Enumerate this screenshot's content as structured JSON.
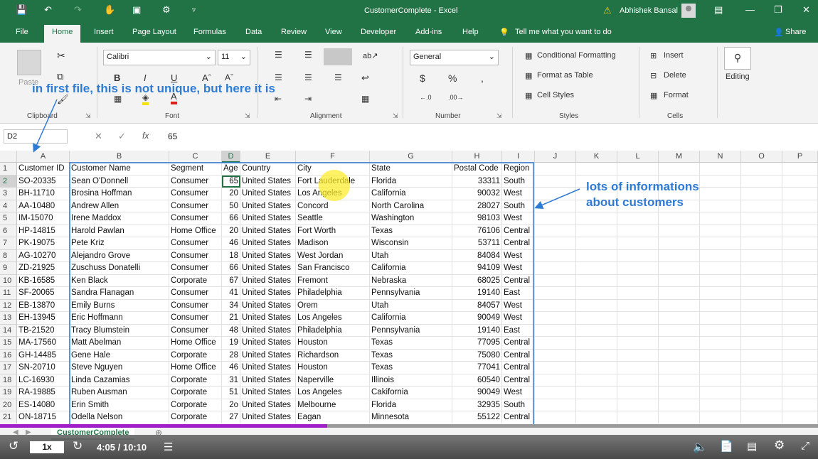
{
  "titlebar": {
    "title": "CustomerComplete  -  Excel",
    "user": "Abhishek Bansal"
  },
  "tabs": [
    "File",
    "Home",
    "Insert",
    "Page Layout",
    "Formulas",
    "Data",
    "Review",
    "View",
    "Developer",
    "Add-ins",
    "Help"
  ],
  "tell_me": "Tell me what you want to do",
  "share": "Share",
  "ribbon": {
    "clipboard": {
      "label": "Clipboard",
      "paste": "Paste"
    },
    "font": {
      "label": "Font",
      "name": "Calibri",
      "size": "11"
    },
    "alignment": {
      "label": "Alignment"
    },
    "number": {
      "label": "Number",
      "format": "General"
    },
    "styles": {
      "label": "Styles",
      "conditional": "Conditional Formatting",
      "table": "Format as Table",
      "cell_styles": "Cell Styles"
    },
    "cells": {
      "label": "Cells",
      "insert": "Insert",
      "delete": "Delete",
      "format": "Format"
    },
    "editing": {
      "label": "Editing"
    }
  },
  "formula": {
    "namebox": "D2",
    "fx": "fx",
    "value": "65"
  },
  "columns": [
    "A",
    "B",
    "C",
    "D",
    "E",
    "F",
    "G",
    "H",
    "I",
    "J",
    "K",
    "L",
    "M",
    "N",
    "O",
    "P"
  ],
  "header_row": [
    "Customer ID",
    "Customer Name",
    "Segment",
    "Age",
    "Country",
    "City",
    "State",
    "Postal Code",
    "Region"
  ],
  "rows": [
    [
      "SO-20335",
      "Sean O'Donnell",
      "Consumer",
      "65",
      "United States",
      "Fort Lauderdale",
      "Florida",
      "33311",
      "South"
    ],
    [
      "BH-11710",
      "Brosina Hoffman",
      "Consumer",
      "20",
      "United States",
      "Los Angeles",
      "California",
      "90032",
      "West"
    ],
    [
      "AA-10480",
      "Andrew Allen",
      "Consumer",
      "50",
      "United States",
      "Concord",
      "North Carolina",
      "28027",
      "South"
    ],
    [
      "IM-15070",
      "Irene Maddox",
      "Consumer",
      "66",
      "United States",
      "Seattle",
      "Washington",
      "98103",
      "West"
    ],
    [
      "HP-14815",
      "Harold Pawlan",
      "Home Office",
      "20",
      "United States",
      "Fort Worth",
      "Texas",
      "76106",
      "Central"
    ],
    [
      "PK-19075",
      "Pete Kriz",
      "Consumer",
      "46",
      "United States",
      "Madison",
      "Wisconsin",
      "53711",
      "Central"
    ],
    [
      "AG-10270",
      "Alejandro Grove",
      "Consumer",
      "18",
      "United States",
      "West Jordan",
      "Utah",
      "84084",
      "West"
    ],
    [
      "ZD-21925",
      "Zuschuss Donatelli",
      "Consumer",
      "66",
      "United States",
      "San Francisco",
      "California",
      "94109",
      "West"
    ],
    [
      "KB-16585",
      "Ken Black",
      "Corporate",
      "67",
      "United States",
      "Fremont",
      "Nebraska",
      "68025",
      "Central"
    ],
    [
      "SF-20065",
      "Sandra Flanagan",
      "Consumer",
      "41",
      "United States",
      "Philadelphia",
      "Pennsylvania",
      "19140",
      "East"
    ],
    [
      "EB-13870",
      "Emily Burns",
      "Consumer",
      "34",
      "United States",
      "Orem",
      "Utah",
      "84057",
      "West"
    ],
    [
      "EH-13945",
      "Eric Hoffmann",
      "Consumer",
      "21",
      "United States",
      "Los Angeles",
      "California",
      "90049",
      "West"
    ],
    [
      "TB-21520",
      "Tracy Blumstein",
      "Consumer",
      "48",
      "United States",
      "Philadelphia",
      "Pennsylvania",
      "19140",
      "East"
    ],
    [
      "MA-17560",
      "Matt Abelman",
      "Home Office",
      "19",
      "United States",
      "Houston",
      "Texas",
      "77095",
      "Central"
    ],
    [
      "GH-14485",
      "Gene Hale",
      "Corporate",
      "28",
      "United States",
      "Richardson",
      "Texas",
      "75080",
      "Central"
    ],
    [
      "SN-20710",
      "Steve Nguyen",
      "Home Office",
      "46",
      "United States",
      "Houston",
      "Texas",
      "77041",
      "Central"
    ],
    [
      "LC-16930",
      "Linda Cazamias",
      "Corporate",
      "31",
      "United States",
      "Naperville",
      "Illinois",
      "60540",
      "Central"
    ],
    [
      "RA-19885",
      "Ruben Ausman",
      "Corporate",
      "51",
      "United States",
      "Los Angeles",
      "Cakifornia",
      "90049",
      "West"
    ],
    [
      "ES-14080",
      "Erin Smith",
      "Corporate",
      "2o",
      "United States",
      "Melbourne",
      "Florida",
      "32935",
      "South"
    ],
    [
      "ON-18715",
      "Odella Nelson",
      "Corporate",
      "27",
      "United States",
      "Eagan",
      "Minnesota",
      "55122",
      "Central"
    ]
  ],
  "sheet_tab": "CustomerComplete",
  "annotations": {
    "left": "in first file, this is not unique, but here it is",
    "right_line1": "lots of informations",
    "right_line2": "about customers",
    "color": "#2e7bd4"
  },
  "player": {
    "speed": "1x",
    "time": "4:05 / 10:10",
    "progress": 0.4
  }
}
